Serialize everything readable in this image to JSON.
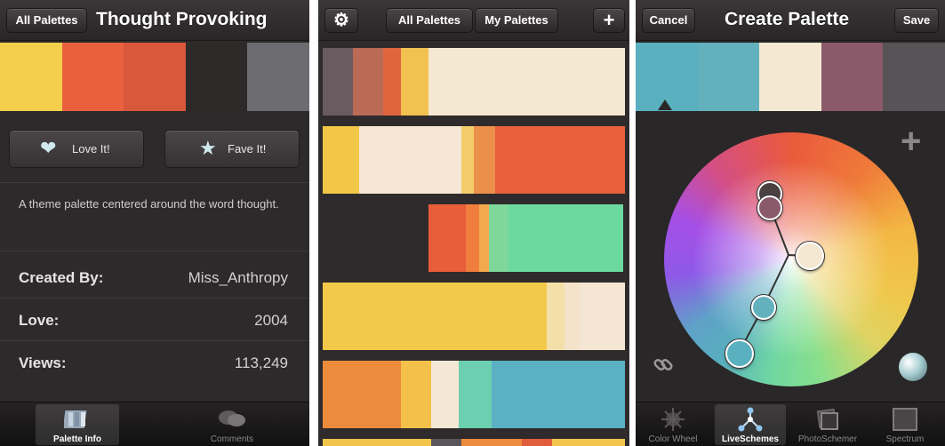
{
  "screen1": {
    "nav_back_label": "All Palettes",
    "title": "Thought Provoking",
    "palette_colors": [
      "#f3cf4b",
      "#e9603f",
      "#d9573a",
      "#2c2929",
      "#6d6c70"
    ],
    "love_label": "Love It!",
    "fave_label": "Fave It!",
    "description": "A theme palette centered around the word thought.",
    "rows": [
      {
        "label": "Created By:",
        "value": "Miss_Anthropy"
      },
      {
        "label": "Love:",
        "value": "2004"
      },
      {
        "label": "Views:",
        "value": "113,249"
      }
    ],
    "tabs": [
      {
        "label": "Palette Info",
        "icon": "palette-info-icon"
      },
      {
        "label": "Comments",
        "icon": "comments-icon"
      }
    ]
  },
  "screen2": {
    "settings_icon": "gear-icon",
    "tab_all": "All Palettes",
    "tab_mine": "My Palettes",
    "add_icon": "plus-icon",
    "palettes": [
      [
        "#6a5b60",
        "#bb6a56",
        "#e0653f",
        "#f1c24f",
        "#f5e8d2"
      ],
      [
        "#f1c745",
        "#f5e7d3",
        "#f3cc6a",
        "#ec8f4a",
        "#e85f3b"
      ],
      [
        "#e85d3a",
        "#ef7e3e",
        "#f2a94c",
        "#7fd89a",
        "#6cd99e"
      ],
      [
        "#f2c94a",
        "#f2c94a",
        "#f3dfa8",
        "#f4e3c9",
        "#f5e6d4"
      ],
      [
        "#ec8b3b",
        "#f3c04a",
        "#f5e7d5",
        "#6bcfb0",
        "#5ab1c3"
      ],
      [
        "#f1c549",
        "#5a5558",
        "#ec8b3b",
        "#e25d3c",
        "#f3c64b"
      ]
    ]
  },
  "screen3": {
    "cancel_label": "Cancel",
    "title": "Create Palette",
    "save_label": "Save",
    "palette_colors": [
      "#5ab0bf",
      "#63b1bd",
      "#f5e8d3",
      "#8a5a6a",
      "#575356"
    ],
    "tabs": [
      {
        "label": "Color Wheel",
        "icon": "color-wheel-icon"
      },
      {
        "label": "LiveSchemes",
        "icon": "live-schemes-icon"
      },
      {
        "label": "PhotoSchemer",
        "icon": "photo-schemer-icon"
      },
      {
        "label": "Spectrum",
        "icon": "spectrum-icon"
      }
    ]
  }
}
